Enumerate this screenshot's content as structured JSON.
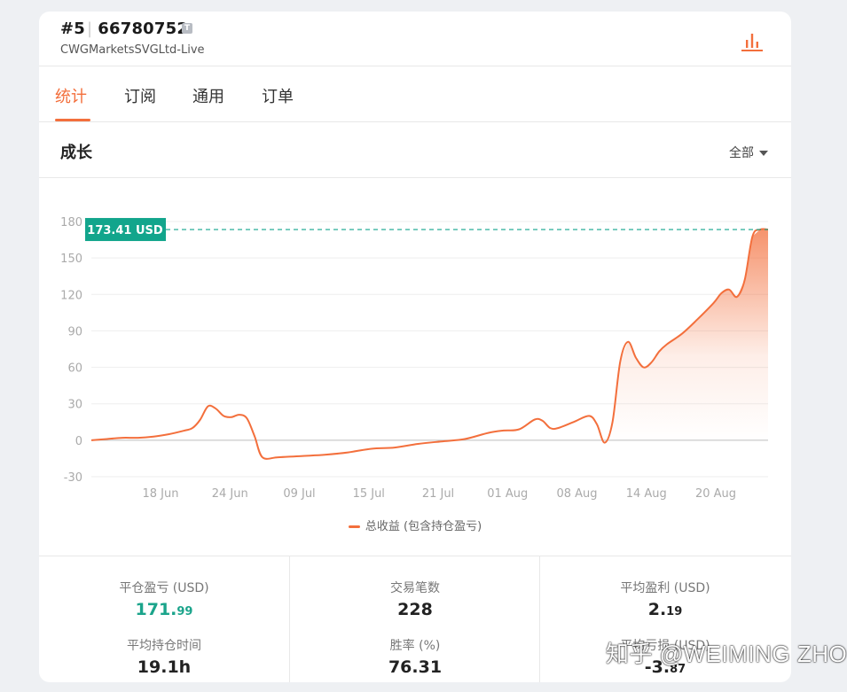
{
  "header": {
    "account_index": "#5",
    "account_number": "66780752",
    "account_badge": "T",
    "server": "CWGMarketsSVGLtd-Live",
    "chart_icon": "bar-chart-icon"
  },
  "tabs": [
    {
      "label": "统计",
      "active": true
    },
    {
      "label": "订阅",
      "active": false
    },
    {
      "label": "通用",
      "active": false
    },
    {
      "label": "订单",
      "active": false
    }
  ],
  "section": {
    "title": "成长",
    "filter_label": "全部"
  },
  "chart_data": {
    "type": "area",
    "series": [
      {
        "name": "总收益 (包含持仓盈亏)",
        "color": "#f36f3c",
        "points": [
          [
            "2025-06-08",
            0
          ],
          [
            "2025-06-10",
            1
          ],
          [
            "2025-06-12",
            2
          ],
          [
            "2025-06-14",
            2
          ],
          [
            "2025-06-16",
            3
          ],
          [
            "2025-06-18",
            5
          ],
          [
            "2025-06-20",
            8
          ],
          [
            "2025-06-21",
            10
          ],
          [
            "2025-06-22",
            17
          ],
          [
            "2025-06-23",
            28
          ],
          [
            "2025-06-24",
            26
          ],
          [
            "2025-06-25",
            20
          ],
          [
            "2025-06-26",
            19
          ],
          [
            "2025-06-27",
            21
          ],
          [
            "2025-06-28",
            18
          ],
          [
            "2025-06-29",
            3
          ],
          [
            "2025-06-30",
            -14
          ],
          [
            "2025-07-02",
            -14
          ],
          [
            "2025-07-05",
            -13
          ],
          [
            "2025-07-08",
            -12
          ],
          [
            "2025-07-11",
            -10
          ],
          [
            "2025-07-14",
            -7
          ],
          [
            "2025-07-17",
            -6
          ],
          [
            "2025-07-20",
            -3
          ],
          [
            "2025-07-23",
            -1
          ],
          [
            "2025-07-26",
            1
          ],
          [
            "2025-07-29",
            6
          ],
          [
            "2025-07-31",
            8
          ],
          [
            "2025-08-02",
            9
          ],
          [
            "2025-08-04",
            17
          ],
          [
            "2025-08-05",
            16
          ],
          [
            "2025-08-06",
            10
          ],
          [
            "2025-08-07",
            10
          ],
          [
            "2025-08-09",
            15
          ],
          [
            "2025-08-11",
            20
          ],
          [
            "2025-08-12",
            13
          ],
          [
            "2025-08-13",
            -2
          ],
          [
            "2025-08-14",
            15
          ],
          [
            "2025-08-15",
            65
          ],
          [
            "2025-08-16",
            81
          ],
          [
            "2025-08-17",
            68
          ],
          [
            "2025-08-18",
            60
          ],
          [
            "2025-08-19",
            64
          ],
          [
            "2025-08-20",
            73
          ],
          [
            "2025-08-21",
            79
          ],
          [
            "2025-08-23",
            88
          ],
          [
            "2025-08-25",
            100
          ],
          [
            "2025-08-27",
            113
          ],
          [
            "2025-08-28",
            121
          ],
          [
            "2025-08-29",
            124
          ],
          [
            "2025-08-30",
            118
          ],
          [
            "2025-08-31",
            132
          ],
          [
            "2025-09-01",
            168
          ],
          [
            "2025-09-02",
            173.41
          ],
          [
            "2025-09-03",
            173.41
          ]
        ]
      }
    ],
    "x_ticks": [
      "18 Jun",
      "24 Jun",
      "09 Jul",
      "15 Jul",
      "21 Jul",
      "01 Aug",
      "08 Aug",
      "14 Aug",
      "20 Aug"
    ],
    "y_ticks": [
      180,
      150,
      120,
      90,
      60,
      30,
      0,
      -30
    ],
    "ylim": [
      -30,
      180
    ],
    "current_value": 173.41,
    "current_label": "173.41 USD",
    "grid": true,
    "legend_position": "bottom-center",
    "accent_color": "#f36f3c",
    "marker_color": "#12a58c"
  },
  "stats": {
    "closed_pnl": {
      "label": "平仓盈亏 (USD)",
      "int": "171.",
      "dec": "99"
    },
    "trades": {
      "label": "交易笔数",
      "value": "228"
    },
    "avg_profit": {
      "label": "平均盈利 (USD)",
      "int": "2.",
      "dec": "19"
    },
    "avg_hold": {
      "label": "平均持仓时间",
      "value": "19.1h"
    },
    "win_rate": {
      "label": "胜率 (%)",
      "value": "76.31"
    },
    "avg_loss": {
      "label": "平均亏损 (USD)",
      "int": "-3.",
      "dec": "87"
    }
  },
  "watermark": "知乎 @WEIMING ZHOU"
}
